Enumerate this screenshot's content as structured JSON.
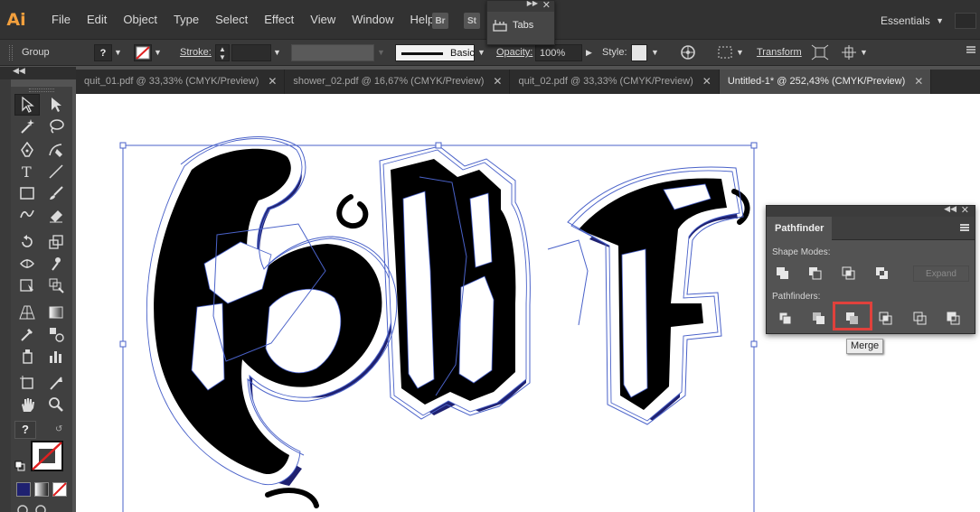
{
  "app": {
    "logo": "Ai"
  },
  "menu": [
    "File",
    "Edit",
    "Object",
    "Type",
    "Select",
    "Effect",
    "View",
    "Window",
    "Help"
  ],
  "bridge_buttons": [
    "Br",
    "St"
  ],
  "tabs_palette": {
    "label": "Tabs"
  },
  "workspace": {
    "label": "Essentials"
  },
  "control_bar": {
    "selection_type": "Group",
    "fill_swatch": "?",
    "stroke_label": "Stroke:",
    "brush_label": "Basic",
    "opacity_label": "Opacity:",
    "opacity_value": "100%",
    "style_label": "Style:",
    "transform_label": "Transform"
  },
  "document_tabs": [
    {
      "label": "quit_01.pdf @ 33,33% (CMYK/Preview)",
      "active": false
    },
    {
      "label": "shower_02.pdf @ 16,67% (CMYK/Preview)",
      "active": false
    },
    {
      "label": "quit_02.pdf @ 33,33% (CMYK/Preview)",
      "active": false
    },
    {
      "label": "Untitled-1* @ 252,43% (CMYK/Preview)",
      "active": true
    }
  ],
  "tools_panel": {
    "default_fill_label": "?"
  },
  "pathfinder": {
    "title": "Pathfinder",
    "shape_modes_label": "Shape Modes:",
    "pathfinders_label": "Pathfinders:",
    "expand_label": "Expand",
    "tooltip": "Merge",
    "shape_mode_icons": [
      "unite-icon",
      "minus-front-icon",
      "intersect-icon",
      "exclude-icon"
    ],
    "pathfinder_icons": [
      "divide-icon",
      "trim-icon",
      "merge-icon",
      "crop-icon",
      "outline-icon",
      "minus-back-icon"
    ]
  },
  "colors": {
    "highlight": "#e0413c",
    "path_blue": "#4a62c9",
    "shadow_navy": "#1f2170"
  }
}
